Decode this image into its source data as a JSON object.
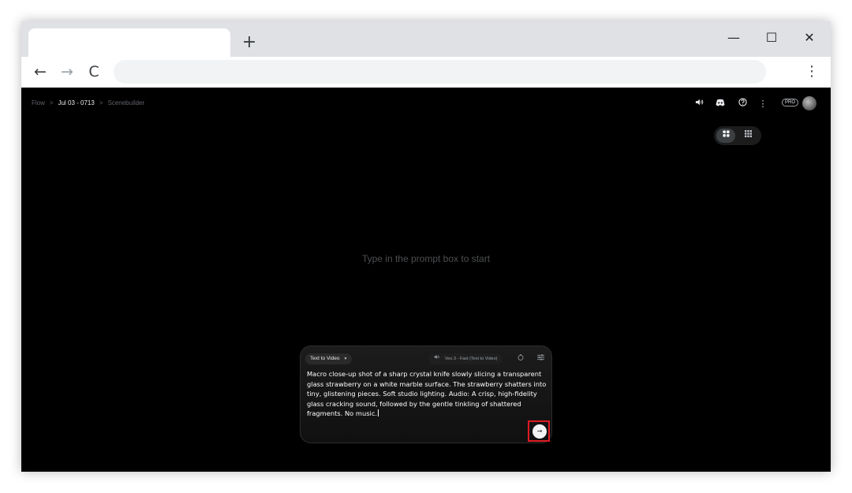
{
  "browser": {
    "tab_title": "",
    "new_tab_glyph": "+",
    "window_controls": {
      "minimize": "—",
      "maximize": "☐",
      "close": "✕"
    },
    "nav": {
      "back": "←",
      "forward": "→",
      "reload": "C"
    },
    "address": "",
    "menu_glyph": "⋮"
  },
  "breadcrumb": {
    "items": [
      "Flow",
      "Jul 03 - 0713",
      "Scenebuilder"
    ],
    "separator": ">"
  },
  "header": {
    "icons": [
      "sound-icon",
      "discord-icon",
      "help-icon",
      "more-vert-icon"
    ],
    "icon_glyphs": {
      "sound": "🔊",
      "discord": "◘",
      "help": "?",
      "more": "⋮"
    },
    "plan_badge": "PRO"
  },
  "view_toggle": {
    "options": [
      "grid-large-icon",
      "grid-small-icon"
    ],
    "glyphs": [
      "▦",
      "▦"
    ],
    "selected": 0
  },
  "empty_state": {
    "text": "Type in the prompt box to start"
  },
  "prompt": {
    "mode": "Text to Video",
    "mode_caret": "▼",
    "model": "Veo 3 - Fast (Text to Video)",
    "model_icon_glyph": "🔊",
    "timer_glyph": "◷",
    "settings_glyph": "☰",
    "text": "Macro close-up shot of a sharp crystal knife slowly slicing a transparent glass strawberry on a white marble surface. The strawberry shatters into tiny, glistening pieces. Soft studio lighting. Audio: A crisp, high-fidelity glass cracking sound, followed by the gentle tinkling of shattered fragments. No music.",
    "send_glyph": "→"
  },
  "colors": {
    "app_background": "#000000",
    "highlight": "#e01b24"
  }
}
